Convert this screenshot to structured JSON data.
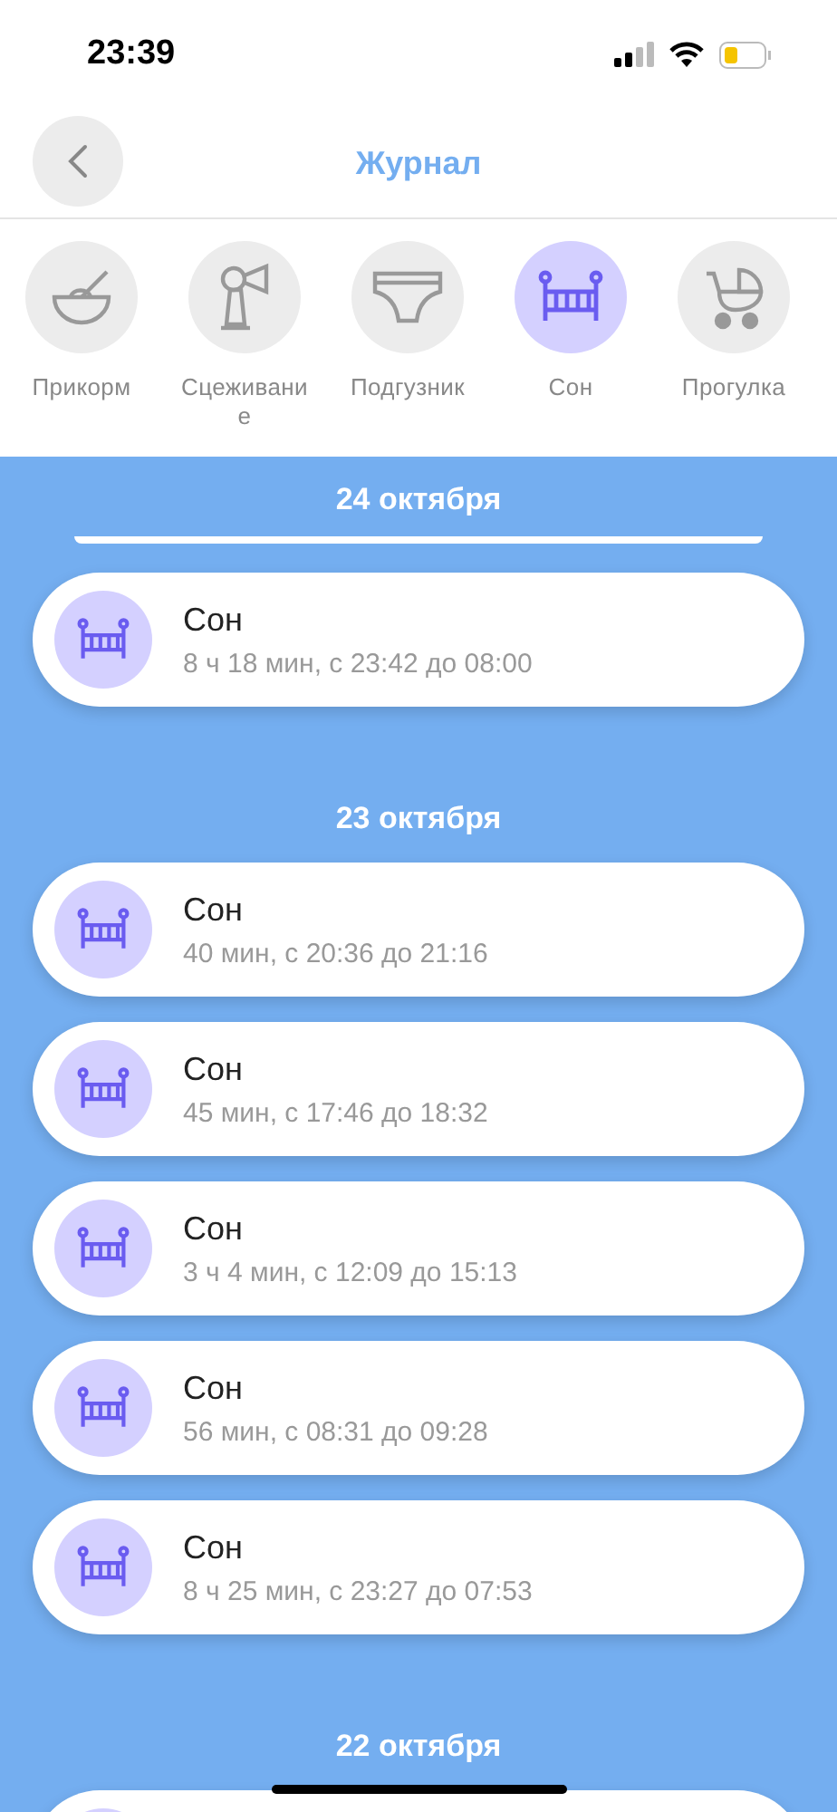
{
  "status_bar": {
    "time": "23:39"
  },
  "header": {
    "title": "Журнал"
  },
  "categories": [
    {
      "label": "Прикорм",
      "kind": "bowl",
      "selected": false
    },
    {
      "label": "Сцеживание",
      "kind": "pump",
      "selected": false
    },
    {
      "label": "Подгузник",
      "kind": "diaper",
      "selected": false
    },
    {
      "label": "Сон",
      "kind": "crib",
      "selected": true
    },
    {
      "label": "Прогулка",
      "kind": "stroller",
      "selected": false
    }
  ],
  "sections": [
    {
      "date": "24 октября",
      "items": [
        {
          "kind": "clipped-top"
        },
        {
          "kind": "entry",
          "title": "Сон",
          "details": "8 ч 18 мин, с 23:42 до 08:00"
        }
      ]
    },
    {
      "date": "23 октября",
      "items": [
        {
          "kind": "entry",
          "title": "Сон",
          "details": "40 мин, с 20:36 до 21:16"
        },
        {
          "kind": "entry",
          "title": "Сон",
          "details": "45 мин, с 17:46 до 18:32"
        },
        {
          "kind": "entry",
          "title": "Сон",
          "details": "3 ч 4 мин, с 12:09 до 15:13"
        },
        {
          "kind": "entry",
          "title": "Сон",
          "details": "56 мин, с 08:31 до 09:28"
        },
        {
          "kind": "entry",
          "title": "Сон",
          "details": "8 ч 25 мин, с 23:27 до 07:53"
        }
      ]
    },
    {
      "date": "22 октября",
      "items": [
        {
          "kind": "clipped-bottom"
        }
      ]
    }
  ]
}
